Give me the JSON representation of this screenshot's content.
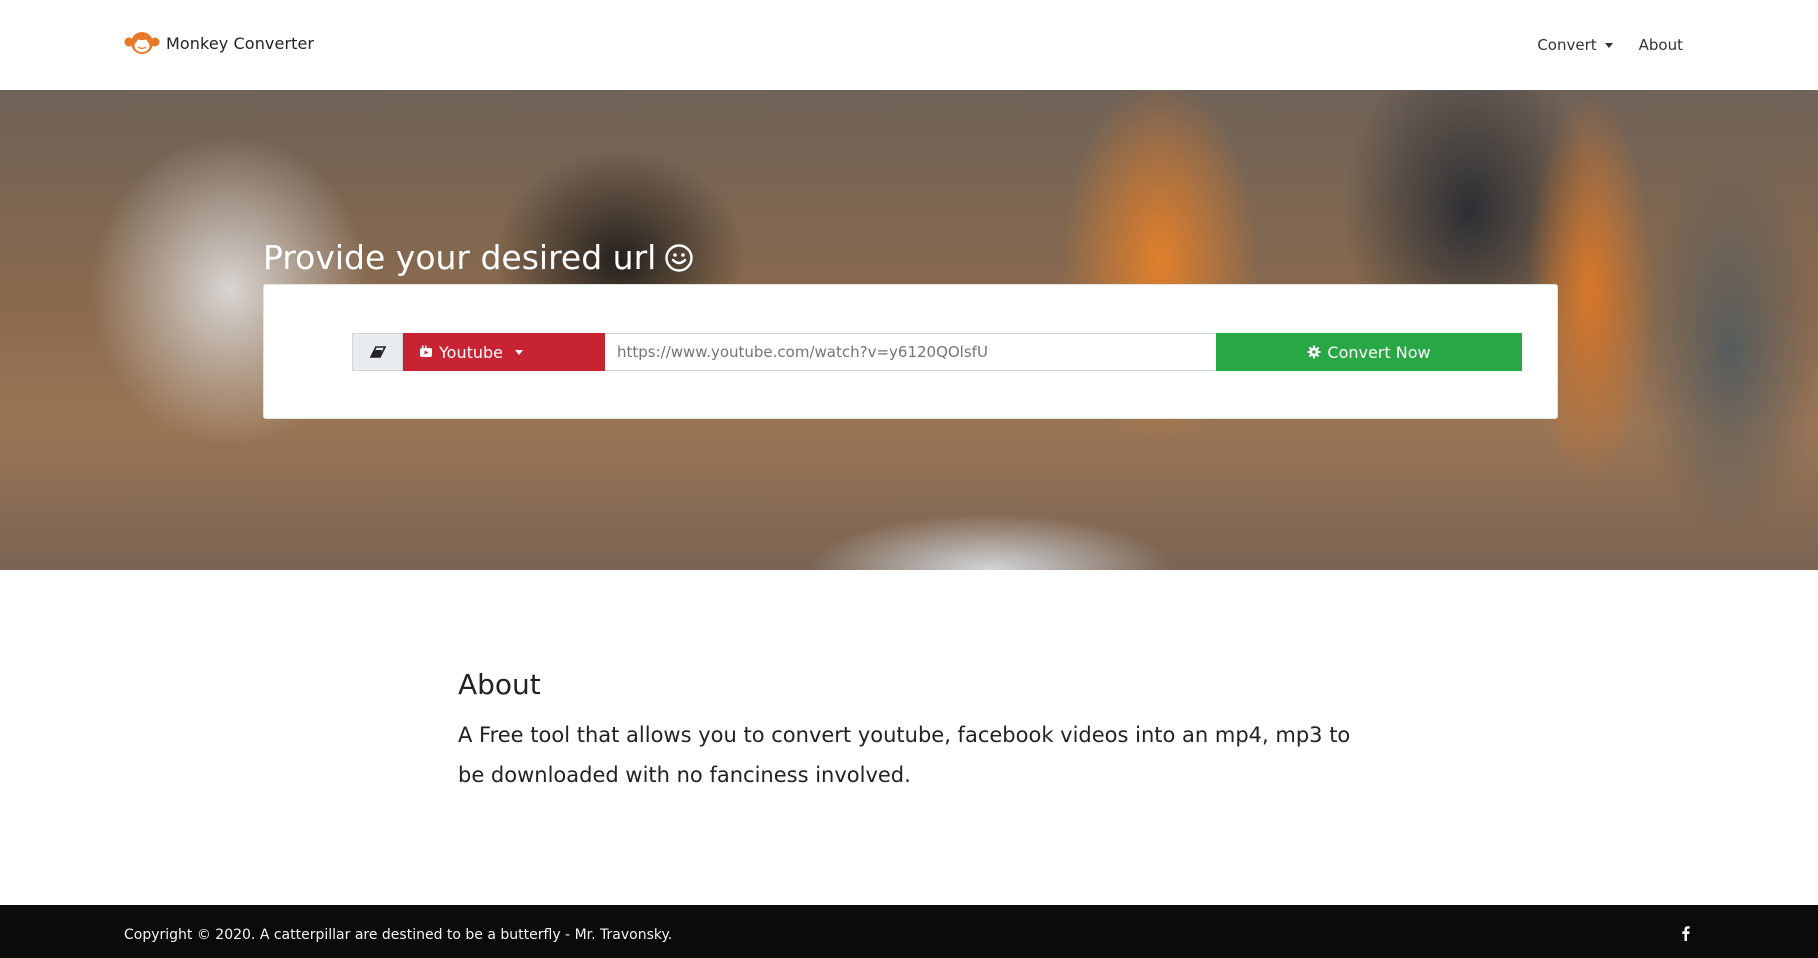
{
  "brand": {
    "name": "Monkey Converter"
  },
  "nav": {
    "convert_label": "Convert",
    "about_label": "About"
  },
  "hero": {
    "title": "Provide your desired url",
    "source_label": "Youtube",
    "url_placeholder": "https://www.youtube.com/watch?v=y6120QOlsfU",
    "convert_label": "Convert Now"
  },
  "about": {
    "heading": "About",
    "text": "A Free tool that allows you to convert youtube, facebook videos into an mp4, mp3 to be downloaded with no fanciness involved."
  },
  "footer": {
    "copyright": "Copyright © 2020. A catterpillar are destined to be a butterfly - Mr. Travonsky."
  },
  "colors": {
    "source_button": "#c82333",
    "convert_button": "#28a745",
    "footer": "#0b0b0b"
  },
  "icons": [
    "monkey-logo-icon",
    "smile-icon",
    "eraser-icon",
    "youtube-icon",
    "chevron-down-icon",
    "gear-icon",
    "facebook-icon"
  ]
}
